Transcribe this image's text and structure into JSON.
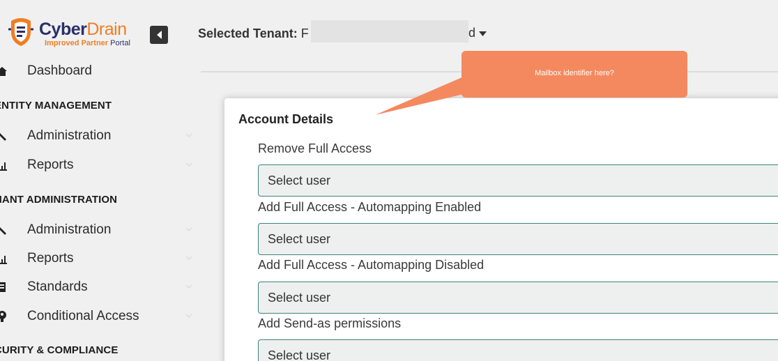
{
  "brand": {
    "name_part1": "Cyber",
    "name_part2": "Drain",
    "subtitle_part1": "Improved Partner",
    "subtitle_part2": " Portal",
    "colors": {
      "navy": "#2b2f6b",
      "orange": "#f07d23"
    }
  },
  "header": {
    "tenant_label": "Selected Tenant:",
    "tenant_value_visible": "F",
    "tenant_value_end": "d"
  },
  "sidebar": {
    "items": [
      {
        "label": "Dashboard",
        "icon": "home-icon"
      }
    ],
    "sections": [
      {
        "title": "ENTITY MANAGEMENT",
        "items": [
          {
            "label": "Administration",
            "icon": "wrench-icon"
          },
          {
            "label": "Reports",
            "icon": "chart-icon"
          }
        ]
      },
      {
        "title": "NANT ADMINISTRATION",
        "items": [
          {
            "label": "Administration",
            "icon": "wrench-icon"
          },
          {
            "label": "Reports",
            "icon": "chart-icon"
          },
          {
            "label": "Standards",
            "icon": "book-icon"
          },
          {
            "label": "Conditional Access",
            "icon": "key-icon"
          }
        ]
      },
      {
        "title": "CURITY & COMPLIANCE",
        "items": []
      }
    ]
  },
  "card": {
    "title": "Account Details",
    "fields": [
      {
        "label": "Remove Full Access",
        "placeholder": "Select user"
      },
      {
        "label": "Add Full Access - Automapping Enabled",
        "placeholder": "Select user"
      },
      {
        "label": "Add Full Access - Automapping Disabled",
        "placeholder": "Select user"
      },
      {
        "label": "Add Send-as permissions",
        "placeholder": "Select user"
      }
    ]
  },
  "callout": {
    "text": "Mailbox identifier here?",
    "color": "#f4895f"
  },
  "colors": {
    "accent_border": "#3e8277",
    "collapse_button": "#333333"
  }
}
